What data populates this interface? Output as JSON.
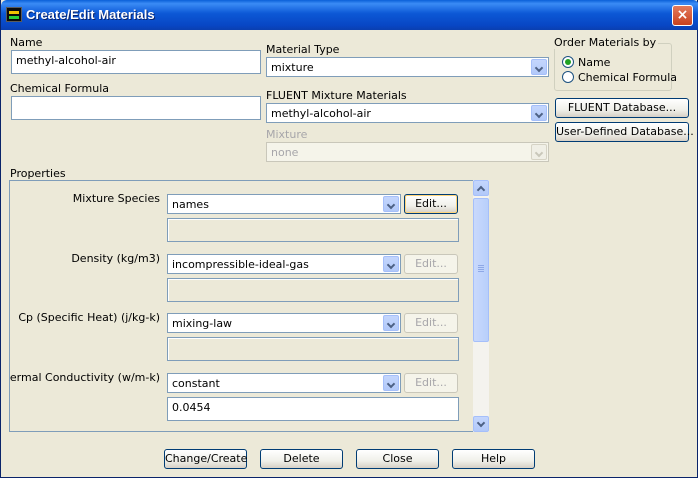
{
  "window": {
    "title": "Create/Edit Materials",
    "close_glyph": "×"
  },
  "name": {
    "label": "Name",
    "value": "methyl-alcohol-air"
  },
  "chemical_formula": {
    "label": "Chemical Formula",
    "value": ""
  },
  "material_type": {
    "label": "Material Type",
    "value": "mixture"
  },
  "fluent_mixture_materials": {
    "label": "FLUENT Mixture Materials",
    "value": "methyl-alcohol-air"
  },
  "mixture": {
    "label": "Mixture",
    "value": "none"
  },
  "order_by": {
    "label": "Order Materials by",
    "options": [
      "Name",
      "Chemical Formula"
    ],
    "selected": "Name"
  },
  "database_buttons": {
    "fluent": "FLUENT Database...",
    "user_defined": "User-Defined Database..."
  },
  "properties": {
    "label": "Properties",
    "rows": [
      {
        "label": "Mixture Species",
        "method": "names",
        "edit": "Edit...",
        "value": ""
      },
      {
        "label": "Density (kg/m3)",
        "method": "incompressible-ideal-gas",
        "edit": "Edit...",
        "value": ""
      },
      {
        "label": "Cp (Specific Heat) (j/kg-k)",
        "method": "mixing-law",
        "edit": "Edit...",
        "value": ""
      },
      {
        "label": "Thermal Conductivity (w/m-k)",
        "method": "constant",
        "edit": "Edit...",
        "value": "0.0454"
      }
    ]
  },
  "footer_buttons": {
    "change_create": "Change/Create",
    "delete": "Delete",
    "close": "Close",
    "help": "Help"
  },
  "colors": {
    "titlebar": "#0a5fd8",
    "dialog_bg": "#ece9d8",
    "field_border": "#7f9db9",
    "disabled_text": "#a7a6aa",
    "radio_dot": "#21a121"
  }
}
